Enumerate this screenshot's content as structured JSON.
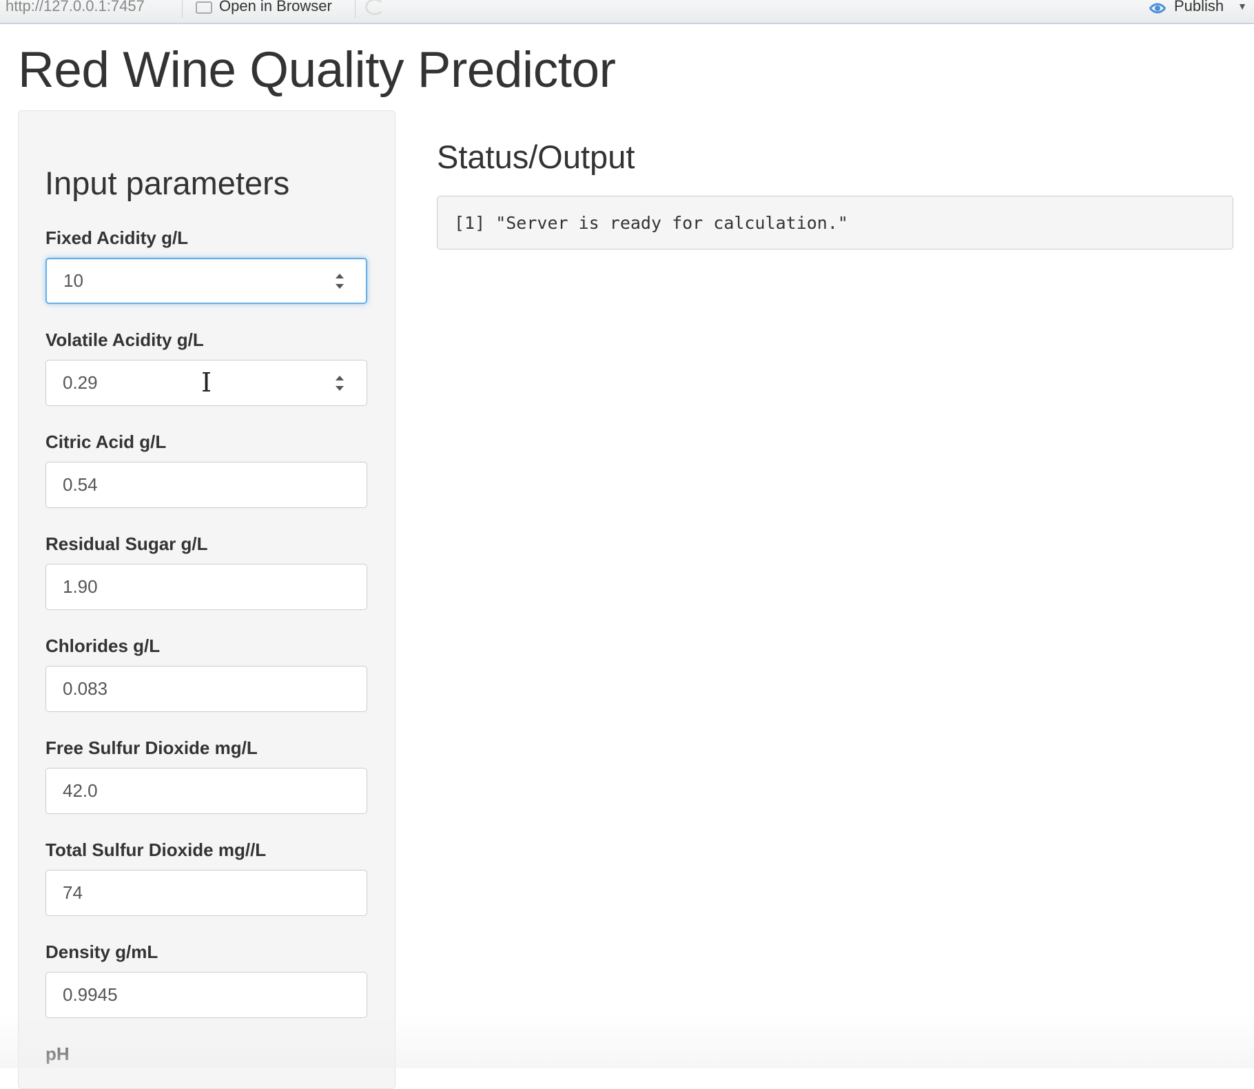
{
  "toolbar": {
    "url": "http://127.0.0.1:7457",
    "open_in_browser_label": "Open in Browser",
    "publish_label": "Publish",
    "publish_icon": "publish-icon",
    "open_icon": "open-in-browser-icon",
    "refresh_icon": "refresh-icon"
  },
  "page": {
    "title": "Red Wine Quality Predictor"
  },
  "sidebar": {
    "heading": "Input parameters",
    "fields": [
      {
        "label": "Fixed Acidity g/L",
        "value": "10"
      },
      {
        "label": "Volatile Acidity g/L",
        "value": "0.29"
      },
      {
        "label": "Citric Acid g/L",
        "value": "0.54"
      },
      {
        "label": "Residual Sugar g/L",
        "value": "1.90"
      },
      {
        "label": "Chlorides g/L",
        "value": "0.083"
      },
      {
        "label": "Free Sulfur Dioxide mg/L",
        "value": "42.0"
      },
      {
        "label": "Total Sulfur Dioxide mg//L",
        "value": "74"
      },
      {
        "label": "Density g/mL",
        "value": "0.9945"
      },
      {
        "label": "pH",
        "value": ""
      }
    ]
  },
  "main": {
    "status_title": "Status/Output",
    "status_text": "[1] \"Server is ready for calculation.\""
  },
  "colors": {
    "focus_border": "#66afe9",
    "sidebar_bg": "#f5f5f5",
    "text": "#333333"
  }
}
